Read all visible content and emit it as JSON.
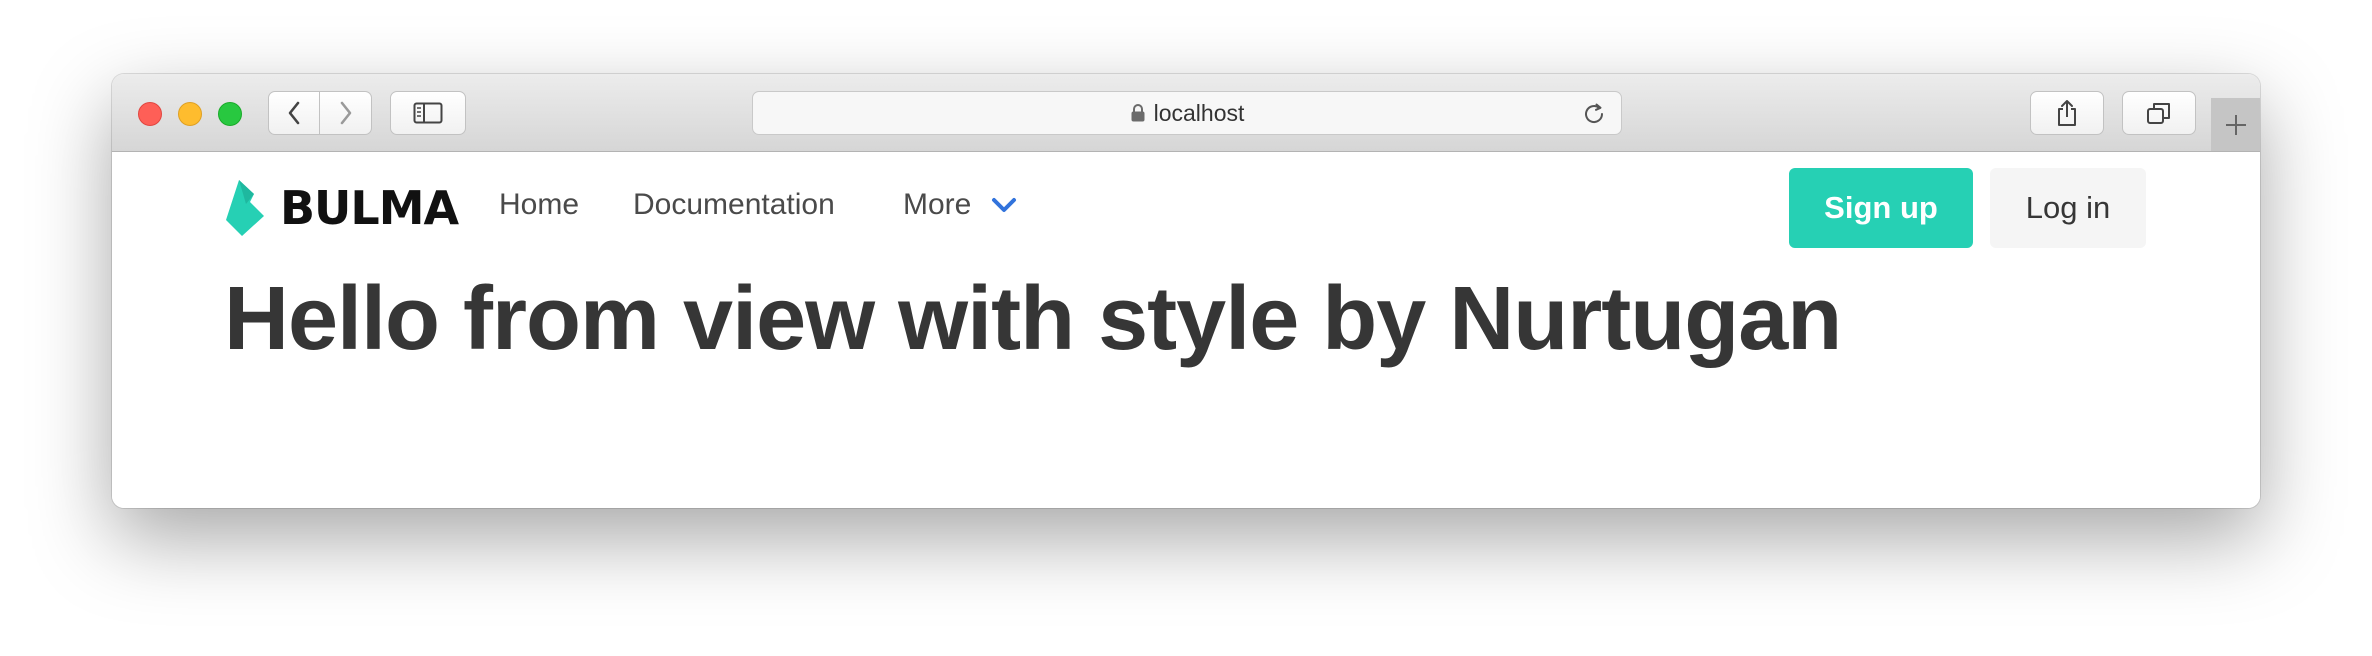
{
  "browser": {
    "address": "localhost",
    "icons": {
      "back": "chevron-left-icon",
      "forward": "chevron-right-icon",
      "sidebar": "sidebar-icon",
      "lock": "lock-icon",
      "reload": "reload-icon",
      "share": "share-icon",
      "tabs": "tabs-icon",
      "new_tab": "plus-icon"
    }
  },
  "navbar": {
    "brand": "BULMA",
    "items": [
      {
        "label": "Home"
      },
      {
        "label": "Documentation"
      },
      {
        "label": "More"
      }
    ],
    "signup_label": "Sign up",
    "login_label": "Log in"
  },
  "main": {
    "title": "Hello from view with style by Nurtugan"
  },
  "colors": {
    "primary": "#26d0b4",
    "link": "#3273dc",
    "text": "#363636",
    "light_button": "#f5f5f5"
  }
}
